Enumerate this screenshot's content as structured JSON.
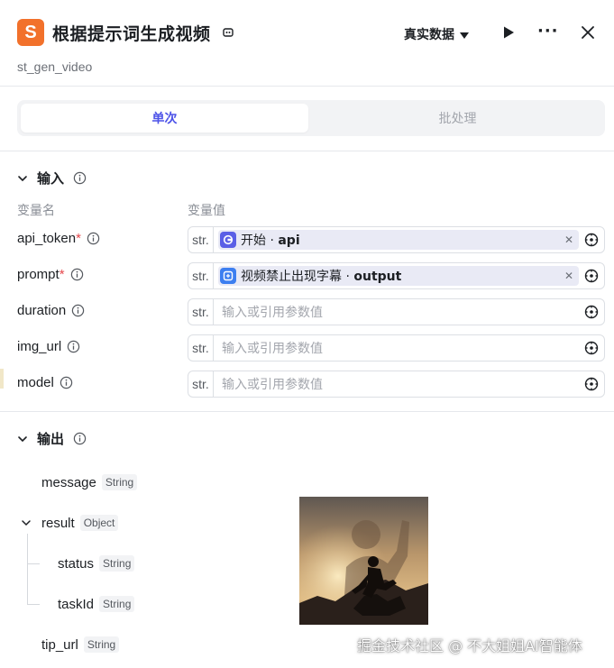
{
  "header": {
    "title": "根据提示词生成视频",
    "subtitle": "st_gen_video",
    "data_mode": "真实数据"
  },
  "tabs": [
    {
      "label": "单次",
      "active": true
    },
    {
      "label": "批处理",
      "active": false
    }
  ],
  "input_section": {
    "title": "输入",
    "col_name": "变量名",
    "col_value": "变量值",
    "rows": [
      {
        "name": "api_token",
        "required": true,
        "type": "str.",
        "ref_node": "开始",
        "ref_sep": " · ",
        "ref_field": "api"
      },
      {
        "name": "prompt",
        "required": true,
        "type": "str.",
        "ref_node": "视频禁止出现字幕",
        "ref_sep": " · ",
        "ref_field": "output"
      },
      {
        "name": "duration",
        "required": false,
        "type": "str.",
        "placeholder": "输入或引用参数值"
      },
      {
        "name": "img_url",
        "required": false,
        "type": "str.",
        "placeholder": "输入或引用参数值"
      },
      {
        "name": "model",
        "required": false,
        "type": "str.",
        "placeholder": "输入或引用参数值"
      }
    ]
  },
  "output_section": {
    "title": "输出",
    "items": [
      {
        "name": "message",
        "type": "String"
      },
      {
        "name": "result",
        "type": "Object"
      },
      {
        "name": "status",
        "type": "String"
      },
      {
        "name": "taskId",
        "type": "String"
      },
      {
        "name": "tip_url",
        "type": "String"
      }
    ]
  },
  "watermark": "掘金技术社区 @ 不大姐姐AI智能体",
  "colors": {
    "accent": "#4d53e8",
    "logo": "#f2712b",
    "required": "#e5484d"
  }
}
